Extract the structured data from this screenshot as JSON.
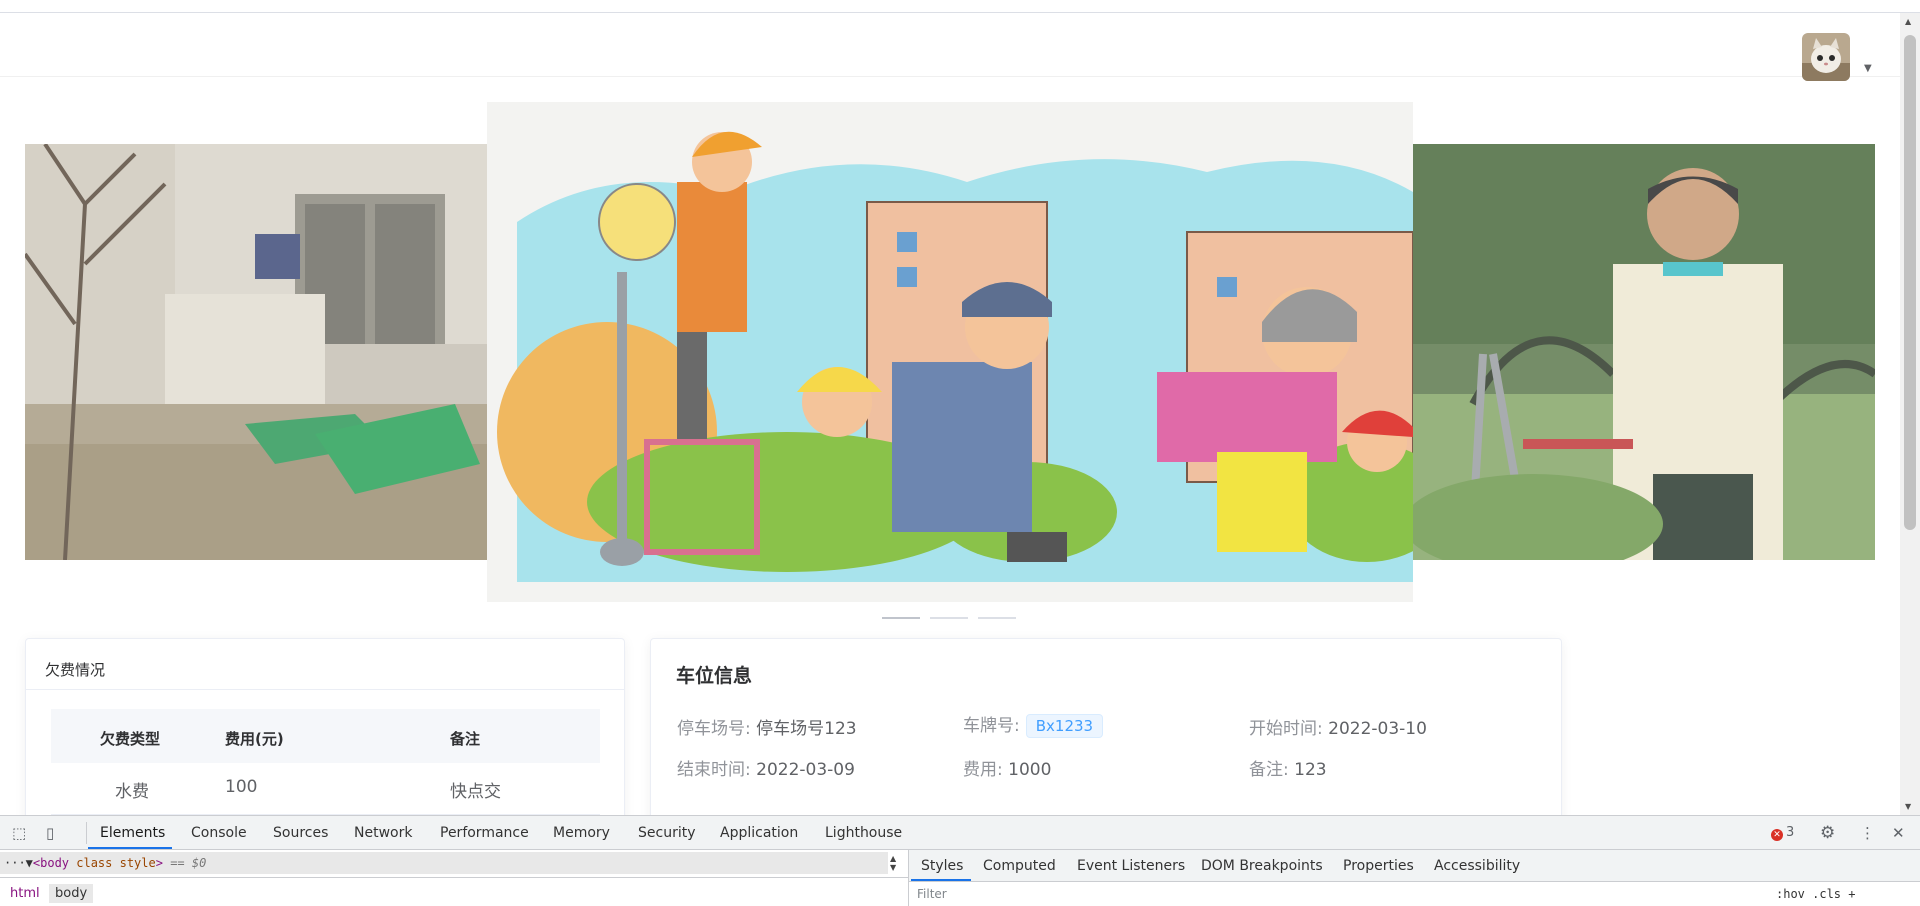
{
  "carousel": {
    "indicator_count": 3,
    "active_index": 0
  },
  "arrears": {
    "title": "欠费情况",
    "columns": [
      "欠费类型",
      "费用(元)",
      "备注"
    ],
    "rows": [
      {
        "type": "水费",
        "fee": "100",
        "note": "快点交"
      }
    ]
  },
  "parking": {
    "title": "车位信息",
    "lot_label": "停车场号:",
    "lot_value": "停车场号123",
    "plate_label": "车牌号:",
    "plate_value": "Bx1233",
    "start_label": "开始时间:",
    "start_value": "2022-03-10",
    "end_label": "结束时间:",
    "end_value": "2022-03-09",
    "fee_label": "费用:",
    "fee_value": "1000",
    "note_label": "备注:",
    "note_value": "123"
  },
  "devtools": {
    "tabs": [
      "Elements",
      "Console",
      "Sources",
      "Network",
      "Performance",
      "Memory",
      "Security",
      "Application",
      "Lighthouse"
    ],
    "active_tab": "Elements",
    "error_count": "3",
    "dom_line": {
      "prefix": "···▼",
      "tag_open": "<body",
      "attr": " class style",
      "tag_close": ">",
      "selected_marker": " == $0"
    },
    "breadcrumbs": [
      "html",
      "body"
    ],
    "subtabs": [
      "Styles",
      "Computed",
      "Event Listeners",
      "DOM Breakpoints",
      "Properties",
      "Accessibility"
    ],
    "active_subtab": "Styles",
    "filter_placeholder": "Filter",
    "hov_cls": ":hov  .cls  +"
  },
  "colors": {
    "accent": "#409eff",
    "devtools_accent": "#1a73e8",
    "error": "#d93025"
  }
}
